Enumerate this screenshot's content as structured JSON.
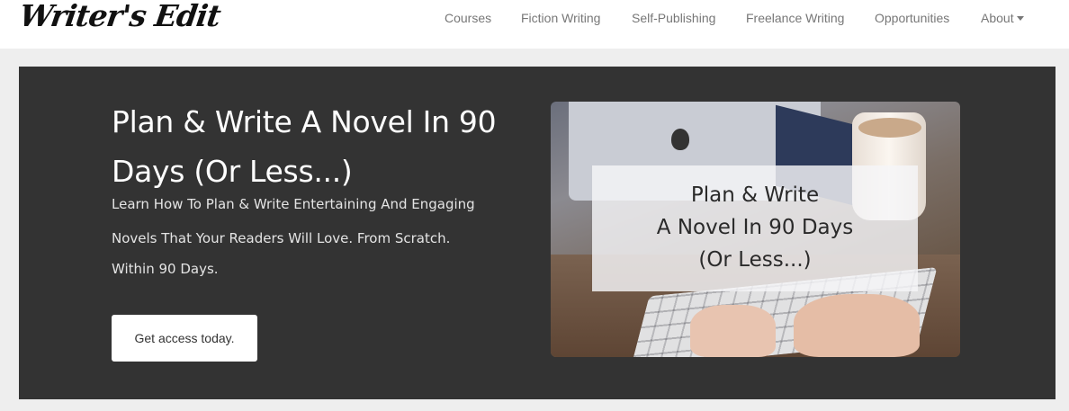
{
  "header": {
    "logo": "Writer's Edit",
    "nav": [
      {
        "label": "Courses"
      },
      {
        "label": "Fiction Writing"
      },
      {
        "label": "Self-Publishing"
      },
      {
        "label": "Freelance Writing"
      },
      {
        "label": "Opportunities"
      },
      {
        "label": "About"
      }
    ]
  },
  "hero": {
    "title": "Plan & Write A Novel In 90 Days (Or Less...)",
    "subtitle_lines": [
      "Learn How To Plan & Write Entertaining And Engaging",
      "Novels That Your Readers Will Love. From Scratch.",
      "Within 90 Days."
    ],
    "cta_label": "Get access today.",
    "image_text_lines": [
      "Plan & Write",
      "A Novel In 90 Days",
      "(Or Less...)"
    ]
  }
}
